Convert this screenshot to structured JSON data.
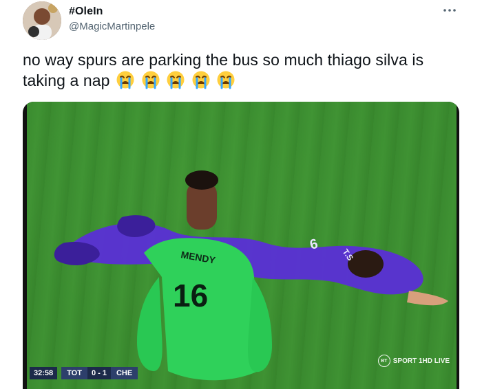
{
  "tweet": {
    "display_name": "#OleIn",
    "handle": "@MagicMartinpele",
    "text": "no way spurs are parking the bus so much thiago silva is taking a nap",
    "emoji": [
      "loudly-crying-face",
      "loudly-crying-face",
      "loudly-crying-face",
      "loudly-crying-face",
      "loudly-crying-face"
    ]
  },
  "icons": {
    "more": "more-horizontal-icon",
    "avatar": "profile-avatar"
  },
  "media": {
    "jersey_name": "MENDY",
    "jersey_number": "16",
    "lying_player_number": "6",
    "lying_player_name_fragment": "T.S",
    "scoreboard": {
      "time": "32:58",
      "home": "TOT",
      "score": "0 - 1",
      "away": "CHE"
    },
    "broadcaster": {
      "badge": "BT",
      "label": "SPORT 1HD LIVE"
    }
  },
  "colors": {
    "text": "#0f1419",
    "muted": "#536471",
    "pitch": "#3f9233",
    "goalkeeper_kit": "#2fd15a",
    "player_kit": "#5a2fd6"
  }
}
